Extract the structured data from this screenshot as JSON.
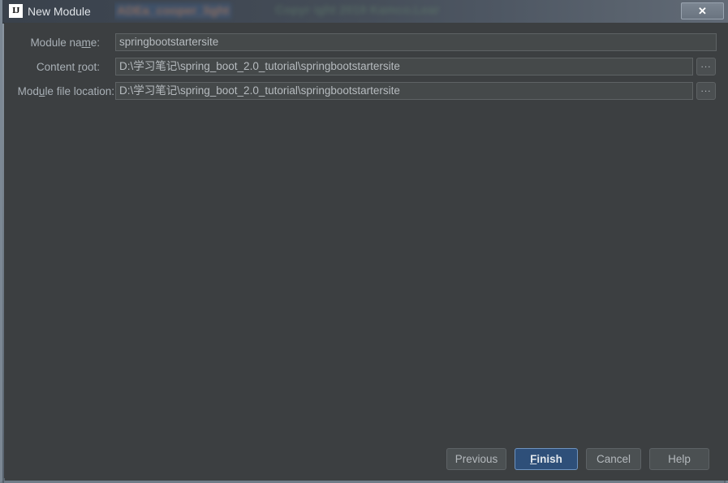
{
  "window": {
    "title": "New Module",
    "logo_text": "IJ",
    "logo_icon": "intellij-idea-icon",
    "close_label": "✕",
    "close_icon": "close-icon",
    "backdrop": {
      "selected_text": "ADEa_cooper_light",
      "dim_text": "Copyr ight  2019  Kamco.Lear"
    }
  },
  "form": {
    "rows": [
      {
        "label_pre": "Module na",
        "label_mnemonic": "m",
        "label_post": "e:",
        "label_full": "Module name:",
        "value": "springbootstartersite",
        "has_browse": false,
        "browse_label": ""
      },
      {
        "label_pre": "Content ",
        "label_mnemonic": "r",
        "label_post": "oot:",
        "label_full": "Content root:",
        "value": "D:\\学习笔记\\spring_boot_2.0_tutorial\\springbootstartersite",
        "has_browse": true,
        "browse_label": "..."
      },
      {
        "label_pre": "Mod",
        "label_mnemonic": "u",
        "label_post": "le file location:",
        "label_full": "Module file location:",
        "value": "D:\\学习笔记\\spring_boot_2.0_tutorial\\springbootstartersite",
        "has_browse": true,
        "browse_label": "..."
      }
    ]
  },
  "footer": {
    "previous_label": "Previous",
    "finish_pre": "",
    "finish_mnemonic": "F",
    "finish_post": "inish",
    "finish_label": "Finish",
    "cancel_label": "Cancel",
    "help_label": "Help"
  },
  "colors": {
    "dialog_background": "#3c3f41",
    "field_background": "#45494a",
    "field_border": "#5e6264",
    "label_text": "#a9b0b6",
    "value_text": "#b6bbbf",
    "default_button_background": "#2e4f79",
    "default_button_border": "#6e93bf",
    "window_frame": "#7c8894"
  }
}
